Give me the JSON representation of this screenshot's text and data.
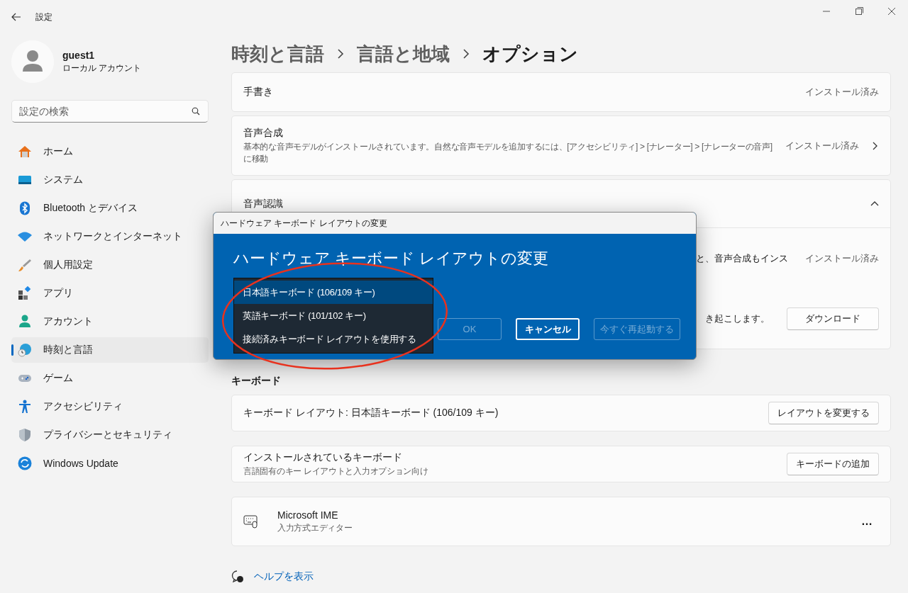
{
  "window": {
    "title": "設定"
  },
  "user": {
    "name": "guest1",
    "account": "ローカル アカウント"
  },
  "search": {
    "placeholder": "設定の検索"
  },
  "nav": [
    {
      "label": "ホーム",
      "selected": false
    },
    {
      "label": "システム",
      "selected": false
    },
    {
      "label": "Bluetooth とデバイス",
      "selected": false
    },
    {
      "label": "ネットワークとインターネット",
      "selected": false
    },
    {
      "label": "個人用設定",
      "selected": false
    },
    {
      "label": "アプリ",
      "selected": false
    },
    {
      "label": "アカウント",
      "selected": false
    },
    {
      "label": "時刻と言語",
      "selected": true
    },
    {
      "label": "ゲーム",
      "selected": false
    },
    {
      "label": "アクセシビリティ",
      "selected": false
    },
    {
      "label": "プライバシーとセキュリティ",
      "selected": false
    },
    {
      "label": "Windows Update",
      "selected": false
    }
  ],
  "breadcrumb": [
    "時刻と言語",
    "言語と地域",
    "オプション"
  ],
  "features": [
    {
      "kind": "plain",
      "title": "手書き",
      "status": "インストール済み"
    },
    {
      "kind": "link",
      "title": "音声合成",
      "description": "基本的な音声モデルがインストールされています。自然な音声モデルを追加するには、[アクセシビリティ] > [ナレーター] > [ナレーターの音声] に移動",
      "status": "インストール済み"
    }
  ],
  "speech": {
    "title": "音声認識",
    "expanded": true,
    "rows": [
      {
        "text": "と、音声合成もインス",
        "status": "インストール済み"
      },
      {
        "text": "き起こします。",
        "button": "ダウンロード"
      }
    ]
  },
  "keyboard_section": {
    "heading": "キーボード",
    "cards": [
      {
        "kind": "button",
        "title": "キーボード レイアウト: 日本語キーボード (106/109 キー)",
        "button": "レイアウトを変更する"
      },
      {
        "kind": "button",
        "title": "インストールされているキーボード",
        "description": "言語固有のキー レイアウトと入力オプション向け",
        "button": "キーボードの追加"
      },
      {
        "kind": "ime",
        "title": "Microsoft IME",
        "description": "入力方式エディター",
        "more": "…"
      }
    ]
  },
  "help": "ヘルプを表示",
  "dialog": {
    "title": "ハードウェア キーボード レイアウトの変更",
    "heading": "ハードウェア キーボード レイアウトの変更",
    "options": [
      {
        "label": "日本語キーボード (106/109 キー)",
        "selected": true
      },
      {
        "label": "英語キーボード (101/102 キー)",
        "selected": false
      },
      {
        "label": "接続済みキーボード レイアウトを使用する",
        "selected": false
      }
    ],
    "buttons": [
      {
        "label": "OK",
        "disabled": true,
        "focused": false
      },
      {
        "label": "キャンセル",
        "disabled": false,
        "focused": true
      },
      {
        "label": "今すぐ再起動する",
        "disabled": true,
        "focused": false
      }
    ]
  }
}
